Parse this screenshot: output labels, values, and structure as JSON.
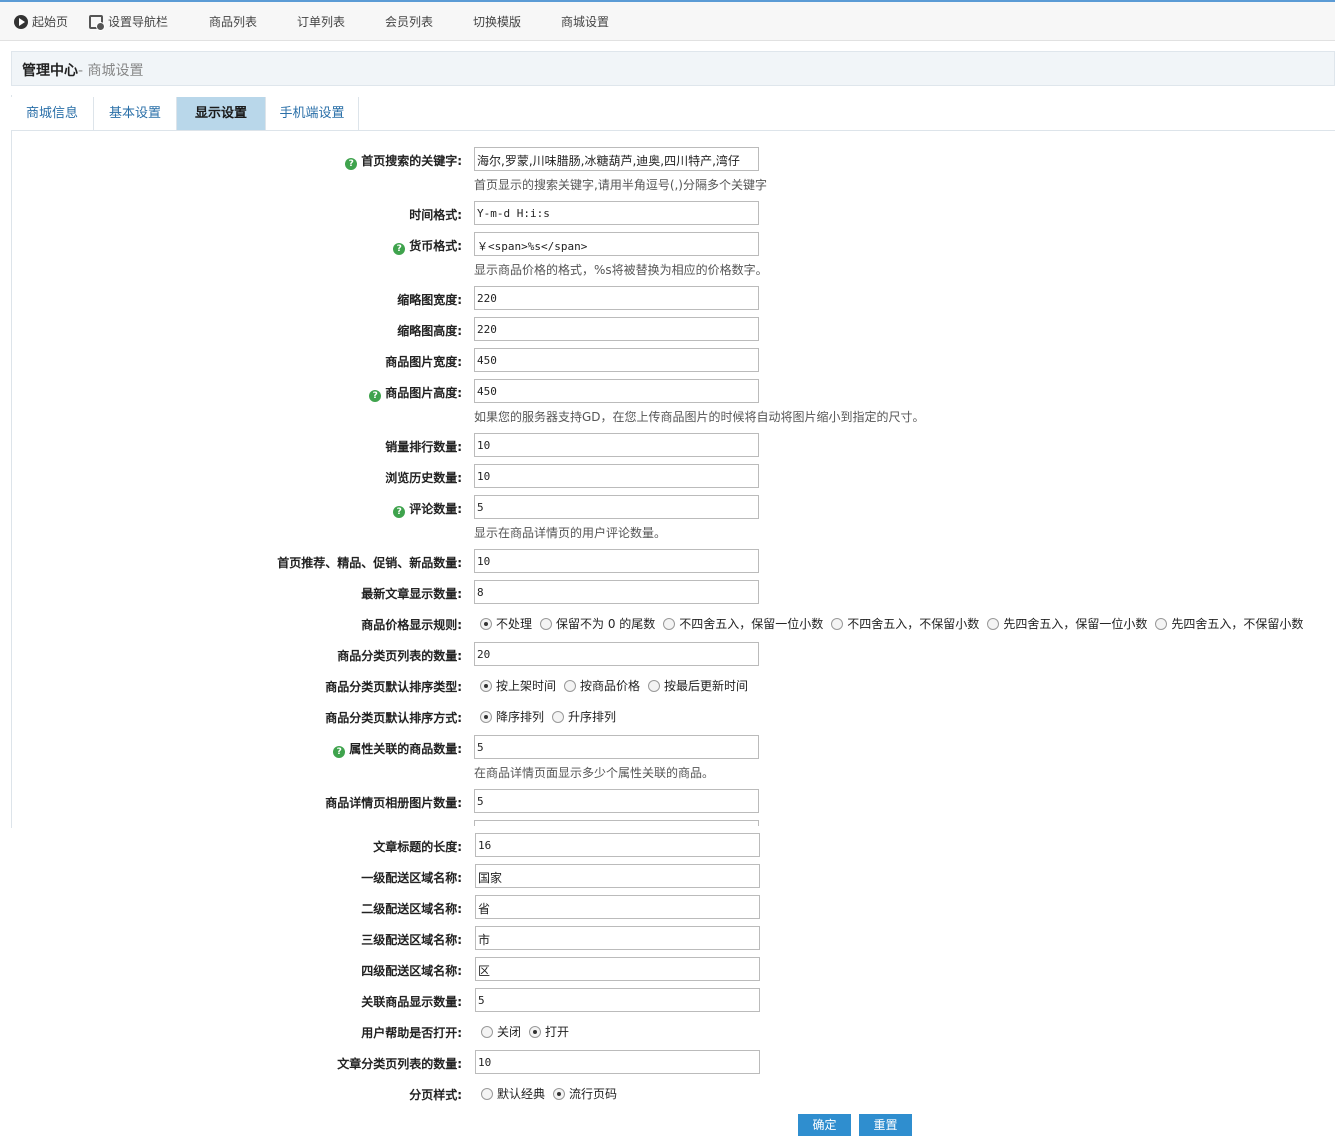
{
  "topnav": {
    "start": "起始页",
    "setnav": "设置导航栏",
    "goods": "商品列表",
    "orders": "订单列表",
    "members": "会员列表",
    "template": "切换模版",
    "shopset": "商城设置"
  },
  "header": {
    "title": "管理中心",
    "sub": "- 商城设置"
  },
  "tabs": {
    "t1": "商城信息",
    "t2": "基本设置",
    "t3": "显示设置",
    "t4": "手机端设置"
  },
  "form": {
    "search_keywords": {
      "label": "首页搜索的关键字:",
      "value": "海尔,罗蒙,川味腊肠,冰糖葫芦,迪奥,四川特产,湾仔",
      "note": "首页显示的搜索关键字,请用半角逗号(,)分隔多个关键字"
    },
    "time_format": {
      "label": "时间格式:",
      "value": "Y-m-d H:i:s"
    },
    "currency_format": {
      "label": "货币格式:",
      "value": "￥<span>%s</span>",
      "note": "显示商品价格的格式，%s将被替换为相应的价格数字。"
    },
    "thumb_width": {
      "label": "缩略图宽度:",
      "value": "220"
    },
    "thumb_height": {
      "label": "缩略图高度:",
      "value": "220"
    },
    "img_width": {
      "label": "商品图片宽度:",
      "value": "450"
    },
    "img_height": {
      "label": "商品图片高度:",
      "value": "450",
      "note": "如果您的服务器支持GD，在您上传商品图片的时候将自动将图片缩小到指定的尺寸。"
    },
    "top_sales": {
      "label": "销量排行数量:",
      "value": "10"
    },
    "history": {
      "label": "浏览历史数量:",
      "value": "10"
    },
    "comments": {
      "label": "评论数量:",
      "value": "5",
      "note": "显示在商品详情页的用户评论数量。"
    },
    "home_counts": {
      "label": "首页推荐、精品、促销、新品数量:",
      "value": "10"
    },
    "article_count": {
      "label": "最新文章显示数量:",
      "value": "8"
    },
    "price_rule": {
      "label": "商品价格显示规则:",
      "options": [
        "不处理",
        "保留不为 0 的尾数",
        "不四舍五入，保留一位小数",
        "不四舍五入，不保留小数",
        "先四舍五入，保留一位小数",
        "先四舍五入，不保留小数"
      ],
      "selected": "不处理"
    },
    "cat_list_count": {
      "label": "商品分类页列表的数量:",
      "value": "20"
    },
    "cat_sort_type": {
      "label": "商品分类页默认排序类型:",
      "options": [
        "按上架时间",
        "按商品价格",
        "按最后更新时间"
      ],
      "selected": "按上架时间"
    },
    "cat_sort_order": {
      "label": "商品分类页默认排序方式:",
      "options": [
        "降序排列",
        "升序排列"
      ],
      "selected": "降序排列"
    },
    "attr_goods": {
      "label": "属性关联的商品数量:",
      "value": "5",
      "note": "在商品详情页面显示多少个属性关联的商品。"
    },
    "gallery_count": {
      "label": "商品详情页相册图片数量:",
      "value": "5"
    },
    "article_title_len": {
      "label": "文章标题的长度:",
      "value": "16"
    },
    "region1": {
      "label": "一级配送区域名称:",
      "value": "国家"
    },
    "region2": {
      "label": "二级配送区域名称:",
      "value": "省"
    },
    "region3": {
      "label": "三级配送区域名称:",
      "value": "市"
    },
    "region4": {
      "label": "四级配送区域名称:",
      "value": "区"
    },
    "related_goods": {
      "label": "关联商品显示数量:",
      "value": "5"
    },
    "help_open": {
      "label": "用户帮助是否打开:",
      "options": [
        "关闭",
        "打开"
      ],
      "selected": "打开"
    },
    "article_cat_count": {
      "label": "文章分类页列表的数量:",
      "value": "10"
    },
    "pager_style": {
      "label": "分页样式:",
      "options": [
        "默认经典",
        "流行页码"
      ],
      "selected": "流行页码"
    }
  },
  "buttons": {
    "submit": "确定",
    "reset": "重置"
  },
  "colors": {
    "accent": "#2f8ecf",
    "tab_active": "#b9d7ea",
    "help": "#3fa34d"
  }
}
